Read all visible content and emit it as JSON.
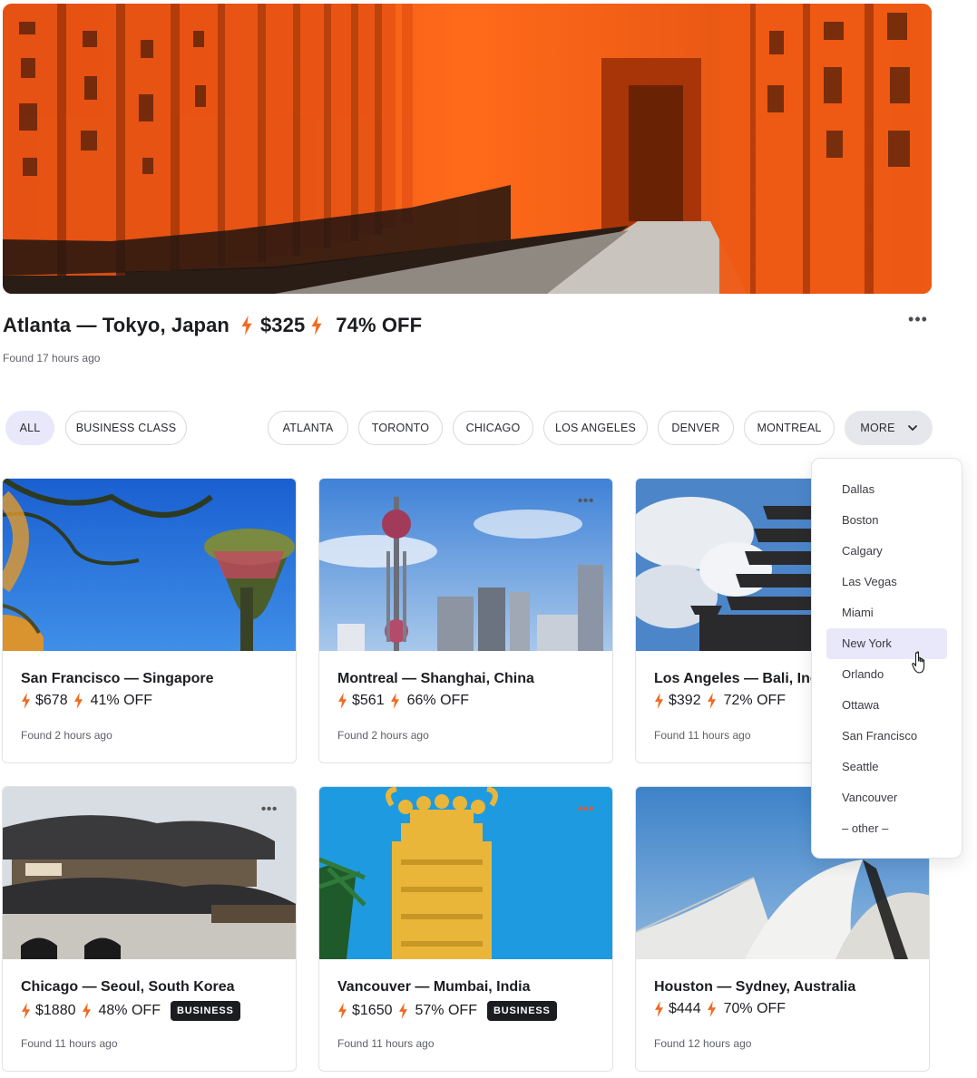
{
  "hero": {
    "route": "Atlanta — Tokyo, Japan",
    "price": "$325",
    "discount": "74% OFF",
    "found": "Found 17 hours ago",
    "more_icon": "ellipsis-icon"
  },
  "filters": {
    "all": "ALL",
    "business": "BUSINESS CLASS",
    "cities": [
      "ATLANTA",
      "TORONTO",
      "CHICAGO",
      "LOS ANGELES",
      "DENVER",
      "MONTREAL"
    ],
    "more": "MORE"
  },
  "dropdown": {
    "items": [
      "Dallas",
      "Boston",
      "Calgary",
      "Las Vegas",
      "Miami",
      "New York",
      "Orlando",
      "Ottawa",
      "San Francisco",
      "Seattle",
      "Vancouver",
      "– other –"
    ],
    "selected": "New York"
  },
  "cards": [
    {
      "route": "San Francisco — Singapore",
      "price": "$678",
      "discount": "41% OFF",
      "found": "Found 2 hours ago",
      "badge": ""
    },
    {
      "route": "Montreal — Shanghai, China",
      "price": "$561",
      "discount": "66% OFF",
      "found": "Found 2 hours ago",
      "badge": ""
    },
    {
      "route": "Los Angeles — Bali, Ind",
      "price": "$392",
      "discount": "72% OFF",
      "found": "Found 11 hours ago",
      "badge": ""
    },
    {
      "route": "Chicago — Seoul, South Korea",
      "price": "$1880",
      "discount": "48% OFF",
      "found": "Found 11 hours ago",
      "badge": "BUSINESS"
    },
    {
      "route": "Vancouver — Mumbai, India",
      "price": "$1650",
      "discount": "57% OFF",
      "found": "Found 11 hours ago",
      "badge": "BUSINESS"
    },
    {
      "route": "Houston — Sydney, Australia",
      "price": "$444",
      "discount": "70% OFF",
      "found": "Found 12 hours ago",
      "badge": ""
    }
  ],
  "colors": {
    "accent_bolt": "#f26a21",
    "pill_active": "#e9e8fb",
    "badge_bg": "#1c1d21"
  }
}
